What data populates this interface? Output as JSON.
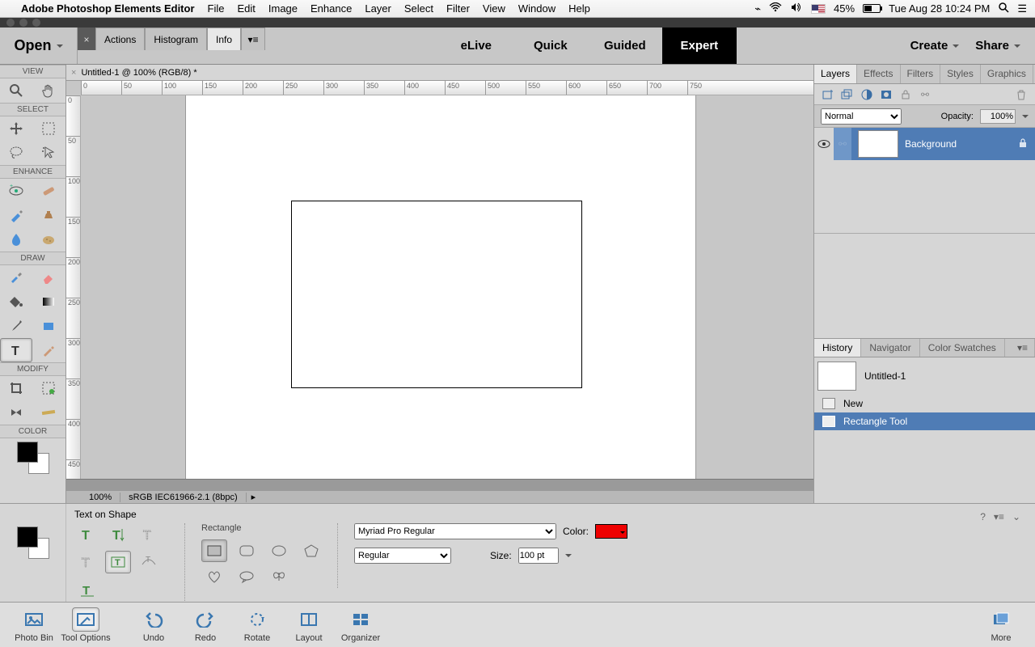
{
  "menubar": {
    "app": "Adobe Photoshop Elements Editor",
    "items": [
      "File",
      "Edit",
      "Image",
      "Enhance",
      "Layer",
      "Select",
      "Filter",
      "View",
      "Window",
      "Help"
    ],
    "battery": "45%",
    "clock": "Tue Aug 28  10:24 PM"
  },
  "workspace": {
    "open": "Open",
    "small_tabs": [
      "Actions",
      "Histogram",
      "Info"
    ],
    "small_active": "Info",
    "modes": [
      "eLive",
      "Quick",
      "Guided",
      "Expert"
    ],
    "mode_active": "Expert",
    "create": "Create",
    "share": "Share"
  },
  "document": {
    "tab": "Untitled-1 @ 100% (RGB/8) *",
    "zoom": "100%",
    "profile": "sRGB IEC61966-2.1 (8bpc)"
  },
  "toolbox": {
    "sections": [
      "VIEW",
      "SELECT",
      "ENHANCE",
      "DRAW",
      "MODIFY",
      "COLOR"
    ]
  },
  "layers_panel": {
    "tabs": [
      "Layers",
      "Effects",
      "Filters",
      "Styles",
      "Graphics"
    ],
    "active": "Layers",
    "blend": "Normal",
    "opacity_label": "Opacity:",
    "opacity": "100%",
    "layer_name": "Background"
  },
  "history_panel": {
    "tabs": [
      "History",
      "Navigator",
      "Color Swatches"
    ],
    "active": "History",
    "doc": "Untitled-1",
    "items": [
      "New",
      "Rectangle Tool"
    ],
    "selected": "Rectangle Tool"
  },
  "options": {
    "title": "Text on Shape",
    "shape_label": "Rectangle",
    "color_label": "Color:",
    "font": "Myriad Pro Regular",
    "style": "Regular",
    "size_label": "Size:",
    "size": "100 pt"
  },
  "bin": {
    "items": [
      "Photo Bin",
      "Tool Options",
      "Undo",
      "Redo",
      "Rotate",
      "Layout",
      "Organizer"
    ],
    "active": "Tool Options",
    "more": "More"
  },
  "ruler_h": [
    0,
    50,
    100,
    150,
    200,
    250,
    300,
    350,
    400,
    450,
    500,
    550,
    600,
    650,
    700,
    750
  ],
  "ruler_v": [
    0,
    50,
    100,
    150,
    200,
    250,
    300,
    350,
    400,
    450
  ]
}
